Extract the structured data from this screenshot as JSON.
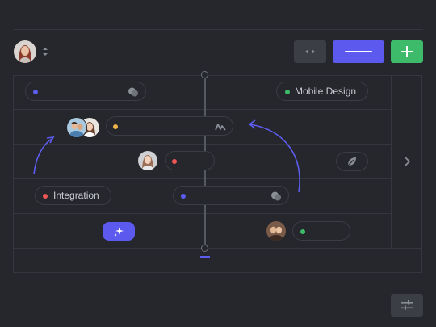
{
  "toolbar": {
    "user_avatar": "woman-avatar",
    "sort_icon": "sort-updown-icon",
    "collapse_icon": "arrows-collapse-icon",
    "primary_icon": "line-icon",
    "add_icon": "plus-icon"
  },
  "board": {
    "pills": [
      {
        "label": "",
        "dot_color": "#5d5cf0",
        "icon": "chat-bubbles-icon"
      },
      {
        "label": "Mobile Design",
        "dot_color": "#3dbb6a",
        "icon": ""
      },
      {
        "label": "",
        "dot_color": "#f0b44a",
        "icon": "activity-icon"
      },
      {
        "label": "",
        "dot_color": "#ef5757",
        "icon": ""
      },
      {
        "label": "Integration",
        "dot_color": "#ef5757",
        "icon": ""
      },
      {
        "label": "",
        "dot_color": "#5d5cf0",
        "icon": "chat-bubbles-icon"
      },
      {
        "label": "",
        "dot_color": "#3dbb6a",
        "icon": ""
      }
    ],
    "magic_icon": "sparkles-icon",
    "leaf_icon": "leaf-icon",
    "next_icon": "chevron-right-icon"
  },
  "footer": {
    "settings_icon": "sliders-icon"
  },
  "colors": {
    "background": "#25272c",
    "accent": "#5d5cf0",
    "success": "#3dbb6a",
    "warning": "#f0b44a",
    "danger": "#ef5757"
  }
}
